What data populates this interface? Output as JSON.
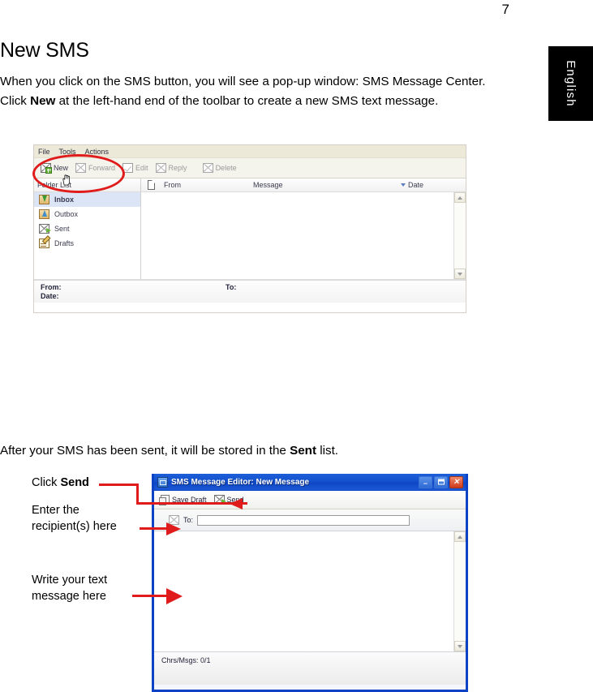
{
  "page": {
    "number": "7",
    "side_tab": "English"
  },
  "doc": {
    "heading": "New SMS",
    "paragraph1_a": "When you click on the SMS button, you will see a pop-up window: SMS Message Center. Click ",
    "paragraph1_bold": "New",
    "paragraph1_b": " at the left-hand end of the toolbar to create a new SMS text message.",
    "paragraph2_a": "After your SMS has been sent, it will be stored in the ",
    "paragraph2_bold": "Sent",
    "paragraph2_b": " list."
  },
  "sms_center": {
    "menus": [
      "File",
      "Tools",
      "Actions"
    ],
    "toolbar": [
      {
        "label": "New",
        "icon": "new-message-icon",
        "disabled": false
      },
      {
        "label": "Forward",
        "icon": "forward-message-icon",
        "disabled": true
      },
      {
        "label": "Edit",
        "icon": "edit-message-icon",
        "disabled": true
      },
      {
        "label": "Reply",
        "icon": "reply-message-icon",
        "disabled": true
      },
      {
        "label": "Delete",
        "icon": "delete-message-icon",
        "disabled": true
      }
    ],
    "folder_pane_title": "Folder List",
    "folders": [
      {
        "label": "Inbox",
        "icon": "inbox-folder-icon",
        "selected": true
      },
      {
        "label": "Outbox",
        "icon": "outbox-folder-icon",
        "selected": false
      },
      {
        "label": "Sent",
        "icon": "sent-folder-icon",
        "selected": false
      },
      {
        "label": "Drafts",
        "icon": "drafts-folder-icon",
        "selected": false
      }
    ],
    "columns": {
      "attachment_icon": "document-icon",
      "from": "From",
      "message": "Message",
      "date": "Date"
    },
    "rows": [],
    "preview": {
      "from_label": "From:",
      "date_label": "Date:",
      "to_label": "To:"
    }
  },
  "sms_editor": {
    "title": "SMS Message Editor: New Message",
    "window_buttons": {
      "minimize": "–",
      "maximize": "",
      "close": "✕"
    },
    "toolbar": [
      {
        "label": "Save Draft",
        "icon": "save-draft-icon"
      },
      {
        "label": "Send",
        "icon": "send-icon"
      }
    ],
    "to_label": "To:",
    "to_value": "",
    "to_placeholder": "",
    "body_value": "",
    "status": "Chrs/Msgs: 0/1"
  },
  "annotations": {
    "click_send_a": "Click ",
    "click_send_bold": "Send",
    "enter_recipients_l1": "Enter the",
    "enter_recipients_l2": "recipient(s) here",
    "write_message_l1": "Write your text",
    "write_message_l2": "message here"
  },
  "colors": {
    "annotation_red": "#e01b1b",
    "title_blue": "#0b43c4",
    "selection_blue": "#dce5f5",
    "tab_black": "#000000"
  }
}
